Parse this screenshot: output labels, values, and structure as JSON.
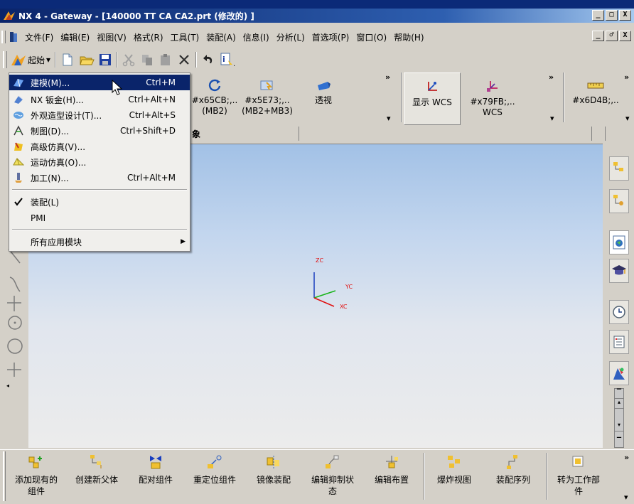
{
  "window": {
    "title": "NX 4 - Gateway - [140000 TT CA CA2.prt (修改的) ]",
    "controls": [
      "_",
      "□",
      "X"
    ],
    "mdi_controls": [
      "_",
      "♂",
      "X"
    ]
  },
  "menubar": {
    "items": [
      "文件(F)",
      "编辑(E)",
      "视图(V)",
      "格式(R)",
      "工具(T)",
      "装配(A)",
      "信息(I)",
      "分析(L)",
      "首选项(P)",
      "窗口(O)",
      "帮助(H)"
    ]
  },
  "standard_toolbar": {
    "start_label": "起始",
    "start_arrow": "▾"
  },
  "view_toolbar": {
    "items": [
      {
        "label": "#x65CB;,..\n(MB2)"
      },
      {
        "label": "#x5E73;,..\n(MB2+MB3)"
      },
      {
        "label": "透视"
      }
    ]
  },
  "wcs_toolbar": {
    "items": [
      {
        "label": "显示 WCS"
      },
      {
        "label": "#x79FB;,..\nWCS"
      }
    ]
  },
  "extra_toolbar": {
    "items": [
      {
        "label": "#x6D4B;,.."
      }
    ]
  },
  "row3": {
    "partial_label": "象"
  },
  "start_menu": {
    "items": [
      {
        "label": "建模(M)...",
        "shortcut": "Ctrl+M",
        "icon": "modeling-icon",
        "selected": true
      },
      {
        "label": "NX 钣金(H)...",
        "shortcut": "Ctrl+Alt+N",
        "icon": "sheet-metal-icon"
      },
      {
        "label": "外观造型设计(T)...",
        "shortcut": "Ctrl+Alt+S",
        "icon": "shape-studio-icon"
      },
      {
        "label": "制图(D)...",
        "shortcut": "Ctrl+Shift+D",
        "icon": "drafting-icon"
      },
      {
        "label": "高级仿真(V)...",
        "shortcut": "",
        "icon": "advanced-simulation-icon"
      },
      {
        "label": "运动仿真(O)...",
        "shortcut": "",
        "icon": "motion-simulation-icon"
      },
      {
        "label": "加工(N)...",
        "shortcut": "Ctrl+Alt+M",
        "icon": "manufacturing-icon"
      },
      {
        "label": "装配(L)",
        "shortcut": "",
        "icon": "check-icon",
        "checked": true
      },
      {
        "label": "PMI",
        "shortcut": "",
        "icon": ""
      },
      {
        "label": "所有应用模块",
        "shortcut": "",
        "icon": "",
        "submenu": true
      }
    ]
  },
  "axes": {
    "zc": "ZC",
    "yc": "YC",
    "xc": "XC",
    "colors": {
      "z": "#1a3fbf",
      "y": "#19b419",
      "x": "#e01010"
    }
  },
  "assembly_toolbar": {
    "items": [
      {
        "label": "添加现有的\n组件"
      },
      {
        "label": "创建新父体"
      },
      {
        "label": "配对组件"
      },
      {
        "label": "重定位组件"
      },
      {
        "label": "镜像装配"
      },
      {
        "label": "编辑抑制状\n态"
      },
      {
        "label": "编辑布置"
      },
      {
        "label": "爆炸视图"
      },
      {
        "label": "装配序列"
      },
      {
        "label": "转为工作部\n件"
      }
    ]
  },
  "colors": {
    "menu_highlight": "#0a246a",
    "chrome": "#d4d0c8",
    "titlebar": "#0a246a"
  }
}
